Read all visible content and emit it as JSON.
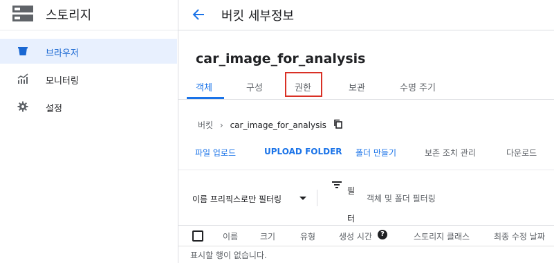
{
  "sidebar": {
    "title": "스토리지",
    "items": [
      {
        "label": "브라우저",
        "icon": "bucket-icon",
        "active": true
      },
      {
        "label": "모니터링",
        "icon": "chart-icon",
        "active": false
      },
      {
        "label": "설정",
        "icon": "gear-icon",
        "active": false
      }
    ]
  },
  "header": {
    "title": "버킷 세부정보"
  },
  "bucket": {
    "name": "car_image_for_analysis"
  },
  "tabs": [
    "객체",
    "구성",
    "권한",
    "보관",
    "수명 주기"
  ],
  "breadcrumb": {
    "root": "버킷",
    "current": "car_image_for_analysis"
  },
  "actions": {
    "upload_files": "파일 업로드",
    "upload_folder": "UPLOAD FOLDER",
    "create_folder": "폴더 만들기",
    "manage_holds": "보존 조치 관리",
    "download": "다운로드"
  },
  "filter": {
    "prefix_label": "이름 프리픽스로만 필터링",
    "filter_label_1": "필",
    "filter_label_2": "터",
    "placeholder": "객체 및 폴더 필터링"
  },
  "table": {
    "columns": [
      "이름",
      "크기",
      "유형",
      "생성 시간",
      "스토리지 클래스",
      "최종 수정 날짜"
    ],
    "empty_message": "표시할 행이 없습니다."
  },
  "colors": {
    "accent": "#1a73e8",
    "active_bg": "#e8f0fe",
    "highlight": "#d93025"
  }
}
